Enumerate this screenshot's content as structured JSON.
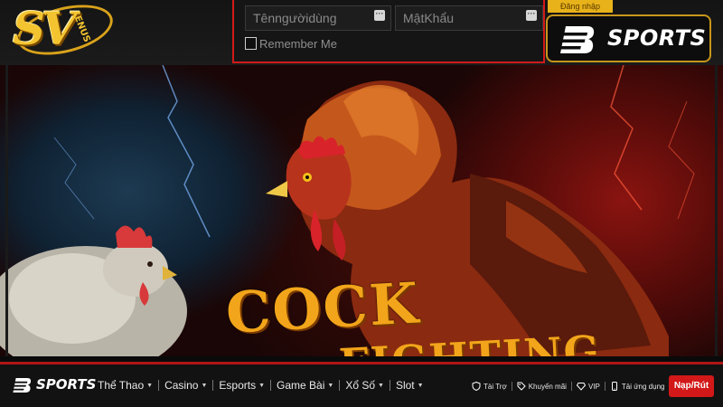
{
  "branding": {
    "casino_logo_monogram": "SV",
    "casino_logo_word": "ENUS",
    "sports_logo_word": "SPORTS",
    "colors": {
      "gold": "#f4c430",
      "accent_red": "#d21818",
      "dark": "#121212"
    }
  },
  "login": {
    "username_placeholder": "Tênngườidùng",
    "password_placeholder": "MậtKhẩu",
    "remember_label": "Remember Me",
    "submit_label": "Đăng nhập",
    "field_icon": "ellipsis-icon"
  },
  "banner": {
    "title": "COCK",
    "subtitle": "FIGHTING"
  },
  "nav": {
    "logo_word": "SPORTS",
    "menu": [
      {
        "label": "Thể Thao",
        "icon": "caret-down-icon"
      },
      {
        "label": "Casino",
        "icon": "caret-down-icon"
      },
      {
        "label": "Esports",
        "icon": "caret-down-icon"
      },
      {
        "label": "Game Bài",
        "icon": "caret-down-icon"
      },
      {
        "label": "Xổ Số",
        "icon": "caret-down-icon"
      },
      {
        "label": "Slot",
        "icon": "caret-down-icon"
      }
    ],
    "links": [
      {
        "label": "Tài Trợ",
        "icon": "shield-icon"
      },
      {
        "label": "Khuyến mãi",
        "icon": "tag-icon"
      },
      {
        "label": "VIP",
        "icon": "diamond-icon"
      },
      {
        "label": "Tải ứng dụng",
        "icon": "phone-icon"
      }
    ],
    "deposit_label": "Nạp/Rút"
  }
}
